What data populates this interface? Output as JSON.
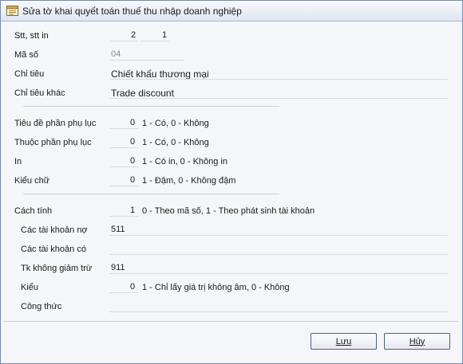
{
  "window": {
    "title": "Sửa tờ khai quyết toán thuế thu nhập doanh nghiệp",
    "icon": "form-icon"
  },
  "fields": {
    "stt_label": "Stt, stt in",
    "stt_value": "2",
    "stt_in_value": "1",
    "ma_so_label": "Mã số",
    "ma_so_value": "04",
    "chi_tieu_label": "Chỉ tiêu",
    "chi_tieu_value": "Chiết khấu thương mại",
    "chi_tieu_khac_label": "Chỉ tiêu khác",
    "chi_tieu_khac_value": "Trade discount",
    "tieu_de_label": "Tiêu đề phần phụ lục",
    "tieu_de_value": "0",
    "tieu_de_hint": "1 - Có, 0 - Không",
    "thuoc_phan_label": "Thuộc phần phụ lục",
    "thuoc_phan_value": "0",
    "thuoc_phan_hint": "1 - Có, 0 - Không",
    "in_label": "In",
    "in_value": "0",
    "in_hint": "1 - Có in, 0 - Không in",
    "kieu_chu_label": "Kiểu chữ",
    "kieu_chu_value": "0",
    "kieu_chu_hint": "1 - Đậm, 0 - Không đậm",
    "cach_tinh_label": "Cách tính",
    "cach_tinh_value": "1",
    "cach_tinh_hint": "0 - Theo mã số, 1 - Theo phát sinh tài khoản",
    "tk_no_label": "Các tài khoản nợ",
    "tk_no_value": "511",
    "tk_co_label": "Các tài khoản có",
    "tk_co_value": "",
    "tk_khong_giam_tru_label": "Tk không giảm trừ",
    "tk_khong_giam_tru_value": "911",
    "kieu_label": "Kiểu",
    "kieu_value": "0",
    "kieu_hint": "1 - Chỉ lấy giá trị không âm, 0 - Không",
    "cong_thuc_label": "Công thức",
    "cong_thuc_value": ""
  },
  "buttons": {
    "save_label": "Lưu",
    "cancel_label": "Hủy"
  }
}
